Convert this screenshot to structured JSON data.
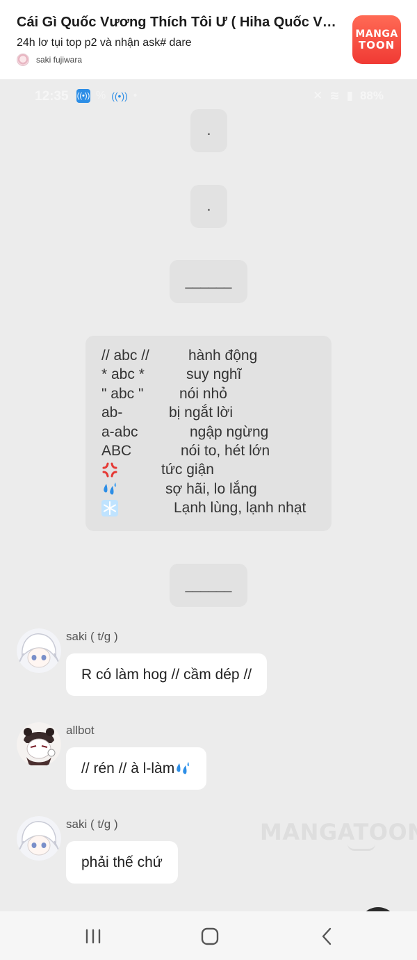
{
  "header": {
    "title": "Cái Gì Quốc Vương Thích Tôi Ư ( Hiha Quốc Vương Thích Tôi Ư )",
    "chapter": "24h lơ tụi top p2 và nhận ask# dare",
    "author": "saki fujiwara",
    "logo_line1": "MANGA",
    "logo_line2": "TOON"
  },
  "status_bar": {
    "time": "12:35",
    "battery": "88%"
  },
  "separators": [
    ".",
    ".",
    "______",
    "______"
  ],
  "legend": [
    {
      "key": "// abc //",
      "value": "hành động"
    },
    {
      "key": "* abc *",
      "value": "suy nghĩ"
    },
    {
      "key": "\" abc \"",
      "value": "nói nhỏ"
    },
    {
      "key": "ab-",
      "value": "bị ngắt lời"
    },
    {
      "key": "a-abc",
      "value": "ngập ngừng"
    },
    {
      "key": "ABC",
      "value": "nói to, hét lớn"
    },
    {
      "key_icon": "anger-icon",
      "value": "tức giận"
    },
    {
      "key_icon": "sweat-drops-icon",
      "value": "sợ hãi, lo lắng"
    },
    {
      "key_icon": "snowflake-icon",
      "value": "Lạnh lùng, lạnh nhạt"
    }
  ],
  "messages": [
    {
      "user": "saki ( t/g )",
      "text": "R có làm hog // cầm dép //",
      "avatar_icon": "white-hair-girl-avatar"
    },
    {
      "user": "allbot",
      "text": "// rén // à l-làm",
      "avatar_icon": "panda-hood-avatar",
      "trailing_icon": "sweat-drops-icon"
    },
    {
      "user": "saki ( t/g )",
      "text": "phải thế chứ",
      "avatar_icon": "white-hair-girl-avatar"
    }
  ],
  "watermark": "MANGATOON",
  "colors": {
    "background": "#ececec",
    "bubble_center": "#e2e2e2",
    "bubble_message": "#ffffff",
    "logo_red": "#f03a34",
    "emoji_blue": "#2d8ee6"
  }
}
